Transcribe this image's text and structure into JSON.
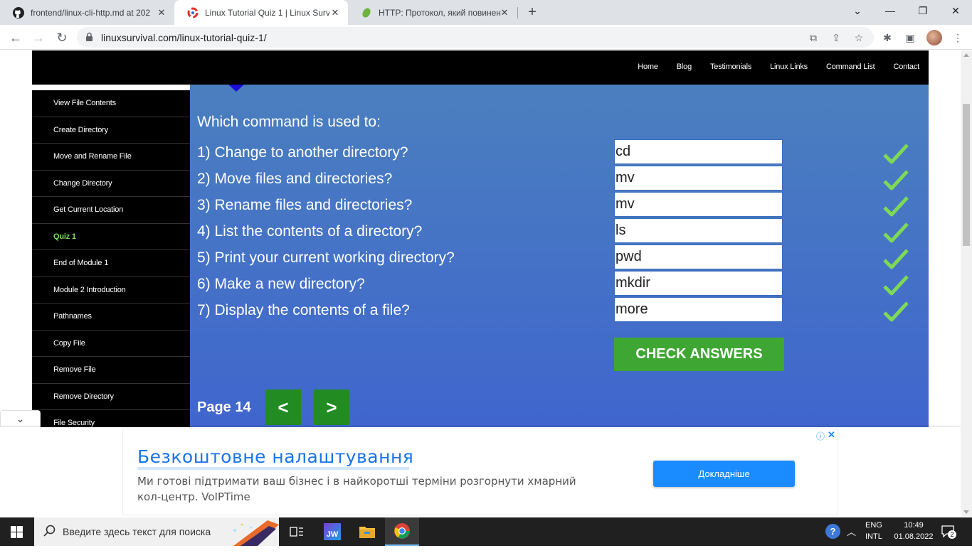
{
  "browser": {
    "tabs": [
      {
        "title": "frontend/linux-cli-http.md at 202",
        "icon": "github-icon",
        "active": false
      },
      {
        "title": "Linux Tutorial Quiz 1 | Linux Surv",
        "icon": "linuxsurvival-icon",
        "active": true
      },
      {
        "title": "HTTP: Протокол, який повинен",
        "icon": "leaf-icon",
        "active": false
      }
    ],
    "url": "linuxsurvival.com/linux-tutorial-quiz-1/"
  },
  "site": {
    "nav": [
      "Home",
      "Blog",
      "Testimonials",
      "Linux Links",
      "Command List",
      "Contact"
    ],
    "sidebar": [
      {
        "label": "View File Contents",
        "active": false
      },
      {
        "label": "Create Directory",
        "active": false
      },
      {
        "label": "Move and Rename File",
        "active": false
      },
      {
        "label": "Change Directory",
        "active": false
      },
      {
        "label": "Get Current Location",
        "active": false
      },
      {
        "label": "Quiz 1",
        "active": true
      },
      {
        "label": "End of Module 1",
        "active": false
      },
      {
        "label": "Module 2 Introduction",
        "active": false
      },
      {
        "label": "Pathnames",
        "active": false
      },
      {
        "label": "Copy File",
        "active": false
      },
      {
        "label": "Remove File",
        "active": false
      },
      {
        "label": "Remove Directory",
        "active": false
      },
      {
        "label": "File Security",
        "active": false
      }
    ]
  },
  "quiz": {
    "heading": "Which command is used to:",
    "questions": [
      {
        "text": "1) Change to another directory?",
        "answer": "cd",
        "correct": true
      },
      {
        "text": "2) Move files and directories?",
        "answer": "mv",
        "correct": true
      },
      {
        "text": "3) Rename files and directories?",
        "answer": "mv",
        "correct": true
      },
      {
        "text": "4) List the contents of a directory?",
        "answer": "ls",
        "correct": true
      },
      {
        "text": "5) Print your current working directory?",
        "answer": "pwd",
        "correct": true
      },
      {
        "text": "6) Make a new directory?",
        "answer": "mkdir",
        "correct": true
      },
      {
        "text": "7) Display the contents of a file?",
        "answer": "more",
        "correct": true
      }
    ],
    "check_button": "CHECK ANSWERS",
    "page_label": "Page 14",
    "prev_label": "<",
    "next_label": ">"
  },
  "ad": {
    "title": "Безкоштовне налаштування",
    "text": "Ми готові підтримати ваш бізнес і в найкоротші терміни розгорнути хмарний кол-центр. VoIPTime",
    "cta": "Докладніше"
  },
  "taskbar": {
    "search_placeholder": "Введите здесь текст для поиска",
    "lang_top": "ENG",
    "lang_bottom": "INTL",
    "time": "10:49",
    "date": "01.08.2022",
    "notifications": "2"
  },
  "colors": {
    "quiz_bg_top": "#4a7fbf",
    "quiz_bg_bottom": "#3d5fd1",
    "check_green": "#3ea733",
    "nav_btn_green": "#228b22",
    "checkmark": "#7ed957",
    "active_sidebar": "#7ed957"
  }
}
